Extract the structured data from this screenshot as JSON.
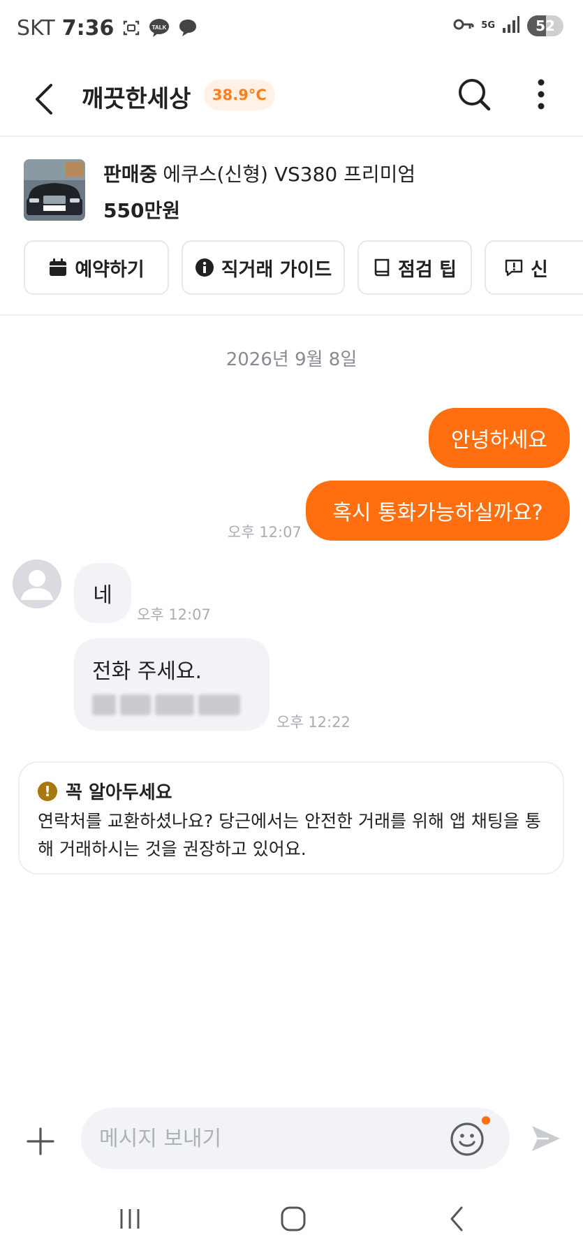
{
  "status_bar": {
    "carrier": "SKT",
    "time": "7:36",
    "network": "5G",
    "battery": "52",
    "battery_level": 0.52
  },
  "header": {
    "title": "깨끗한세상",
    "temperature": "38.9°C"
  },
  "product": {
    "status": "판매중",
    "title": "에쿠스(신형) VS380 프리미엄",
    "price": "550만원",
    "chips": [
      {
        "label": "예약하기",
        "icon": "calendar-icon"
      },
      {
        "label": "직거래 가이드",
        "icon": "info-icon"
      },
      {
        "label": "점검 팁",
        "icon": "book-icon"
      },
      {
        "label": "신",
        "icon": "report-icon"
      }
    ]
  },
  "chat": {
    "date": "2026년 9월 8일",
    "messages": [
      {
        "from": "me",
        "text": "안녕하세요"
      },
      {
        "from": "me",
        "text": "혹시 통화가능하실까요?",
        "time": "오후 12:07"
      },
      {
        "from": "other",
        "text": "네",
        "time": "오후 12:07"
      },
      {
        "from": "other",
        "text": "전화 주세요.",
        "time": "오후 12:22"
      }
    ]
  },
  "notice": {
    "title": "꼭 알아두세요",
    "body": "연락처를 교환하셨나요? 당근에서는 안전한 거래를 위해 앱 채팅을 통해 거래하시는 것을 권장하고 있어요."
  },
  "input": {
    "placeholder": "메시지 보내기"
  },
  "colors": {
    "accent": "#ff6f0f",
    "bubble_in": "#f2f3f6",
    "temp_text": "#ff7e1d"
  }
}
